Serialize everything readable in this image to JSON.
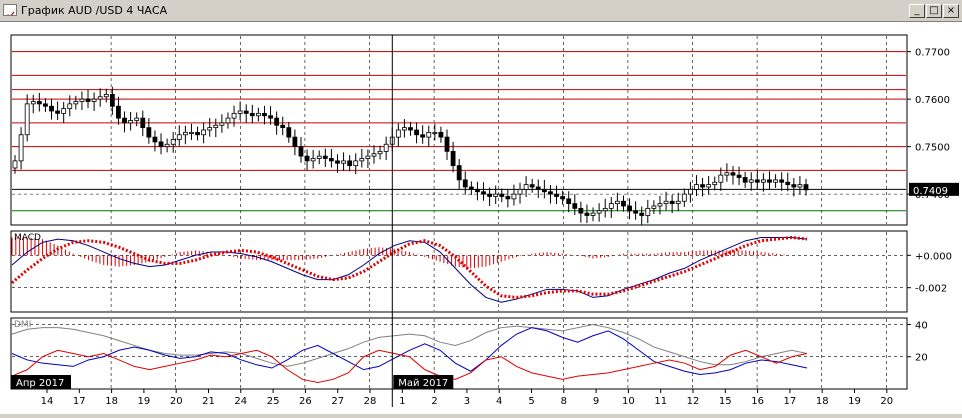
{
  "window": {
    "title": "График AUD /USD  4 ЧАСА",
    "buttons": {
      "minimize": "_",
      "maximize": "□",
      "close": "×"
    }
  },
  "colors": {
    "background": "#ffffff",
    "grid": "#000000",
    "candle": "#000000",
    "resistance_lines": "#cc0000",
    "support_line": "#007700",
    "macd_line": "#000080",
    "macd_signal": "#e00000",
    "macd_histogram": "#e00000",
    "dmi_adx": "#808080",
    "dmi_plus": "#0000c0",
    "dmi_minus": "#e00000"
  },
  "chart_data": [
    {
      "type": "candlestick",
      "symbol": "AUD/USD",
      "timeframe": "4 ЧАСА",
      "ylim": [
        0.7335,
        0.7735
      ],
      "y_ticks": [
        "0.7700",
        "0.7600",
        "0.7500",
        "0.7400"
      ],
      "current_price": "0.7409",
      "horizontal_levels": [
        0.77,
        0.765,
        0.762,
        0.76,
        0.755,
        0.75,
        0.745,
        0.741
      ],
      "support_level": 0.7365,
      "x_labels": [
        "14",
        "17",
        "18",
        "19",
        "20",
        "21",
        "24",
        "25",
        "26",
        "27",
        "28",
        "1",
        "2",
        "3",
        "4",
        "5",
        "8",
        "9",
        "10",
        "11",
        "12",
        "15",
        "16",
        "17",
        "18",
        "19",
        "20"
      ],
      "month_labels": [
        {
          "label": "Апр 2017",
          "at_day": "14"
        },
        {
          "label": "Май 2017",
          "at_day": "1"
        }
      ],
      "closes_approx": [
        0.747,
        0.7525,
        0.759,
        0.7595,
        0.759,
        0.7585,
        0.7575,
        0.757,
        0.758,
        0.759,
        0.7595,
        0.76,
        0.7595,
        0.76,
        0.7605,
        0.761,
        0.7585,
        0.756,
        0.755,
        0.7555,
        0.756,
        0.754,
        0.752,
        0.751,
        0.75,
        0.7505,
        0.7515,
        0.7525,
        0.753,
        0.753,
        0.7525,
        0.7535,
        0.754,
        0.7545,
        0.755,
        0.756,
        0.757,
        0.7575,
        0.757,
        0.7565,
        0.757,
        0.7565,
        0.756,
        0.7545,
        0.754,
        0.752,
        0.75,
        0.748,
        0.747,
        0.7475,
        0.748,
        0.7475,
        0.747,
        0.7465,
        0.747,
        0.746,
        0.747,
        0.7475,
        0.748,
        0.7485,
        0.749,
        0.7505,
        0.752,
        0.7535,
        0.754,
        0.7535,
        0.7525,
        0.752,
        0.753,
        0.753,
        0.752,
        0.749,
        0.746,
        0.743,
        0.7415,
        0.741,
        0.7405,
        0.74,
        0.7395,
        0.74,
        0.7395,
        0.739,
        0.74,
        0.741,
        0.742,
        0.7415,
        0.741,
        0.7405,
        0.74,
        0.7395,
        0.739,
        0.738,
        0.737,
        0.736,
        0.7355,
        0.736,
        0.7365,
        0.737,
        0.738,
        0.7385,
        0.7375,
        0.7365,
        0.736,
        0.7355,
        0.737,
        0.7375,
        0.738,
        0.7385,
        0.738,
        0.7385,
        0.74,
        0.741,
        0.742,
        0.7415,
        0.742,
        0.7425,
        0.744,
        0.7445,
        0.744,
        0.7435,
        0.7425,
        0.743,
        0.7425,
        0.743,
        0.7425,
        0.743,
        0.7425,
        0.742,
        0.7415,
        0.742,
        0.7409
      ]
    },
    {
      "type": "line",
      "name": "MACD",
      "ylim": [
        -0.0035,
        0.0015
      ],
      "y_ticks": [
        "+0.000",
        "-0.002"
      ],
      "series": [
        {
          "role": "main",
          "values": [
            -0.0006,
            0.0002,
            0.0008,
            0.001,
            0.0009,
            0.0006,
            0.0002,
            -0.0002,
            -0.0005,
            -0.0007,
            -0.0006,
            -0.0003,
            0.0,
            0.0002,
            0.0002,
            0.0001,
            -0.0001,
            -0.0004,
            -0.0008,
            -0.0012,
            -0.0015,
            -0.0015,
            -0.0012,
            -0.0006,
            0.0001,
            0.0006,
            0.0009,
            0.0008,
            0.0002,
            -0.0008,
            -0.0018,
            -0.0026,
            -0.0029,
            -0.0027,
            -0.0024,
            -0.0021,
            -0.0021,
            -0.0022,
            -0.0026,
            -0.0025,
            -0.0021,
            -0.0018,
            -0.0015,
            -0.0011,
            -0.0008,
            -0.0003,
            0.0001,
            0.0005,
            0.0009,
            0.0011,
            0.0011,
            0.0011,
            0.001
          ]
        },
        {
          "role": "signal",
          "values": [
            -0.0017,
            -0.0009,
            -0.0002,
            0.0004,
            0.0008,
            0.0009,
            0.0008,
            0.0005,
            0.0001,
            -0.0003,
            -0.0005,
            -0.0005,
            -0.0003,
            0.0,
            0.0002,
            0.0003,
            0.0002,
            -0.0001,
            -0.0005,
            -0.0009,
            -0.0013,
            -0.0015,
            -0.0014,
            -0.001,
            -0.0004,
            0.0002,
            0.0007,
            0.0009,
            0.0006,
            -0.0001,
            -0.001,
            -0.0019,
            -0.0025,
            -0.0026,
            -0.0025,
            -0.0023,
            -0.0022,
            -0.0022,
            -0.0024,
            -0.0024,
            -0.0022,
            -0.0019,
            -0.0016,
            -0.0013,
            -0.001,
            -0.0006,
            -0.0002,
            0.0002,
            0.0006,
            0.0009,
            0.001,
            0.0011,
            0.001
          ]
        }
      ]
    },
    {
      "type": "line",
      "name": "DMI",
      "ylim": [
        0,
        44
      ],
      "y_ticks": [
        "40",
        "20"
      ],
      "series": [
        {
          "role": "adx",
          "values": [
            34,
            37,
            38,
            38,
            37,
            35,
            33,
            30,
            27,
            24,
            22,
            21,
            21,
            22,
            23,
            22,
            19,
            16,
            14,
            16,
            19,
            22,
            25,
            29,
            32,
            33,
            34,
            33,
            29,
            27,
            30,
            35,
            38,
            39,
            38,
            37,
            36,
            38,
            40,
            38,
            35,
            31,
            26,
            23,
            20,
            17,
            15,
            15,
            17,
            20,
            22,
            24,
            22
          ]
        },
        {
          "role": "plus_di",
          "values": [
            22,
            18,
            16,
            15,
            14,
            18,
            20,
            24,
            26,
            24,
            21,
            19,
            20,
            23,
            22,
            18,
            15,
            13,
            18,
            24,
            27,
            22,
            17,
            12,
            14,
            19,
            24,
            28,
            24,
            16,
            11,
            18,
            27,
            34,
            38,
            36,
            32,
            29,
            33,
            36,
            31,
            24,
            17,
            14,
            11,
            9,
            10,
            12,
            16,
            18,
            17,
            15,
            13
          ]
        },
        {
          "role": "minus_di",
          "values": [
            8,
            12,
            20,
            24,
            22,
            20,
            22,
            18,
            14,
            12,
            14,
            16,
            18,
            21,
            20,
            22,
            24,
            20,
            12,
            6,
            4,
            6,
            10,
            20,
            24,
            22,
            20,
            12,
            8,
            6,
            10,
            18,
            20,
            14,
            10,
            8,
            6,
            8,
            9,
            10,
            12,
            14,
            16,
            18,
            16,
            12,
            14,
            21,
            24,
            20,
            16,
            20,
            22
          ]
        }
      ]
    }
  ]
}
